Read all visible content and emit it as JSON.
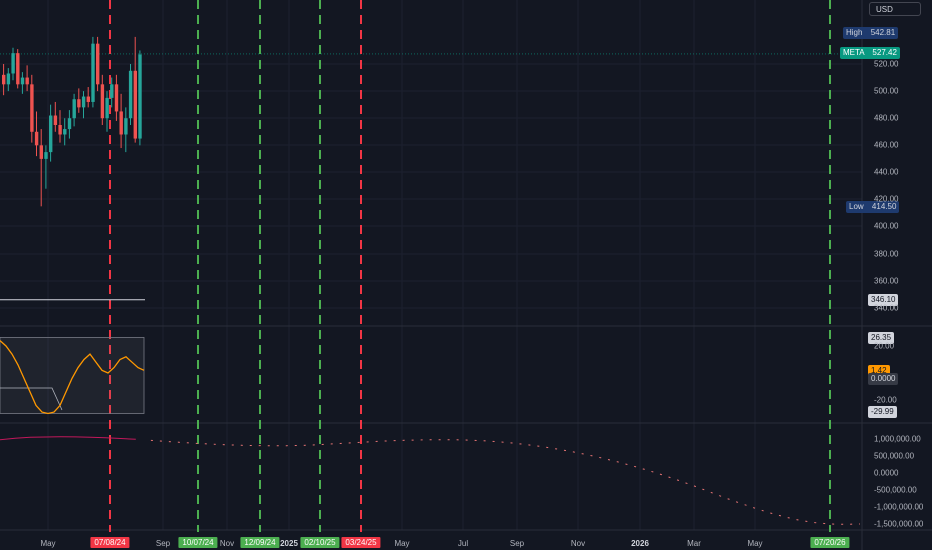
{
  "currency_label": "USD",
  "price_badges": {
    "high": {
      "label": "High",
      "value": "542.81"
    },
    "last": {
      "label": "META",
      "value": "527.42"
    },
    "low": {
      "label": "Low",
      "value": "414.50"
    },
    "level": {
      "value": "346.10"
    }
  },
  "oscillator_badges": {
    "upper": "26.35",
    "value": "1.42",
    "zero": "0.0000",
    "lower": "-29.99"
  },
  "price_ticks": [
    "520.00",
    "500.00",
    "480.00",
    "460.00",
    "440.00",
    "420.00",
    "400.00",
    "380.00",
    "360.00",
    "340.00"
  ],
  "oscillator_ticks": [
    "20.00",
    "-20.00"
  ],
  "volume_ticks": [
    "1,000,000.00",
    "500,000.00",
    "0.0000",
    "-500,000.00",
    "-1,000,000.00",
    "-1,500,000.00"
  ],
  "x_ticks": [
    {
      "label": "May",
      "bold": false
    },
    {
      "label": "Sep",
      "bold": false
    },
    {
      "label": "Nov",
      "bold": false
    },
    {
      "label": "2025",
      "bold": true
    },
    {
      "label": "May",
      "bold": false
    },
    {
      "label": "Jul",
      "bold": false
    },
    {
      "label": "Sep",
      "bold": false
    },
    {
      "label": "Nov",
      "bold": false
    },
    {
      "label": "2026",
      "bold": true
    },
    {
      "label": "Mar",
      "bold": false
    },
    {
      "label": "May",
      "bold": false
    }
  ],
  "vertical_markers": [
    {
      "date": "07/08/24",
      "kind": "red"
    },
    {
      "date": "10/07/24",
      "kind": "green"
    },
    {
      "date": "12/09/24",
      "kind": "green"
    },
    {
      "date": "02/10/25",
      "kind": "green"
    },
    {
      "date": "03/24/25",
      "kind": "red"
    },
    {
      "date": "07/20/26",
      "kind": "green"
    }
  ],
  "colors": {
    "background": "#131722",
    "up": "#26a69a",
    "down": "#ef5350",
    "marker_red": "#f23645",
    "marker_green": "#4caf50",
    "oscillator": "#ff9800",
    "volume_line": "#c2185b",
    "badge_blue": "#1e3a6e",
    "badge_teal": "#089981"
  },
  "chart_data": {
    "type": "candlestick",
    "price_range": [
      330,
      548
    ],
    "last_price": 527.42,
    "high": 542.81,
    "low": 414.5,
    "horizontal_level": 346.1,
    "candles_ohlc": [
      [
        512,
        520,
        497,
        505
      ],
      [
        505,
        517,
        500,
        513
      ],
      [
        513,
        532,
        508,
        528
      ],
      [
        528,
        531,
        502,
        505
      ],
      [
        505,
        514,
        498,
        510
      ],
      [
        510,
        519,
        500,
        505
      ],
      [
        505,
        512,
        462,
        470
      ],
      [
        470,
        485,
        452,
        460
      ],
      [
        460,
        472,
        415,
        450
      ],
      [
        450,
        460,
        428,
        455
      ],
      [
        455,
        490,
        448,
        482
      ],
      [
        482,
        492,
        470,
        475
      ],
      [
        475,
        486,
        462,
        468
      ],
      [
        468,
        480,
        460,
        472
      ],
      [
        472,
        486,
        465,
        480
      ],
      [
        480,
        498,
        474,
        494
      ],
      [
        494,
        502,
        484,
        488
      ],
      [
        488,
        500,
        480,
        496
      ],
      [
        496,
        503,
        488,
        492
      ],
      [
        492,
        540,
        488,
        535
      ],
      [
        535,
        540,
        500,
        505
      ],
      [
        505,
        512,
        475,
        480
      ],
      [
        480,
        500,
        470,
        495
      ],
      [
        495,
        510,
        488,
        505
      ],
      [
        505,
        512,
        478,
        485
      ],
      [
        485,
        498,
        458,
        468
      ],
      [
        468,
        488,
        455,
        480
      ],
      [
        480,
        520,
        475,
        515
      ],
      [
        515,
        540,
        462,
        465
      ],
      [
        465,
        530,
        460,
        527
      ]
    ],
    "oscillator": {
      "upper_band": 26.35,
      "lower_band": -29.99,
      "last": 1.42,
      "values": [
        24,
        20,
        14,
        6,
        -4,
        -14,
        -24,
        -29,
        -30,
        -29,
        -24,
        -14,
        -4,
        4,
        10,
        14,
        8,
        2,
        0,
        4,
        10,
        12,
        8,
        4,
        2
      ]
    },
    "volume_line": {
      "values": [
        980000,
        1020000,
        1050000,
        1060000,
        1065000,
        1062000,
        1050000,
        1035000,
        1015000,
        990000,
        960000,
        930000,
        900000,
        870000,
        850000,
        830000,
        815000,
        805000,
        800000,
        802000,
        812000,
        830000,
        855000,
        880000,
        905000,
        930000,
        950000,
        965000,
        975000,
        980000,
        978000,
        968000,
        950000,
        920000,
        880000,
        830000,
        770000,
        700000,
        620000,
        530000,
        430000,
        320000,
        200000,
        70000,
        -70000,
        -220000,
        -380000,
        -550000,
        -720000,
        -880000,
        -1030000,
        -1170000,
        -1290000,
        -1390000,
        -1460000,
        -1500000,
        -1510000,
        -1500000
      ]
    }
  }
}
